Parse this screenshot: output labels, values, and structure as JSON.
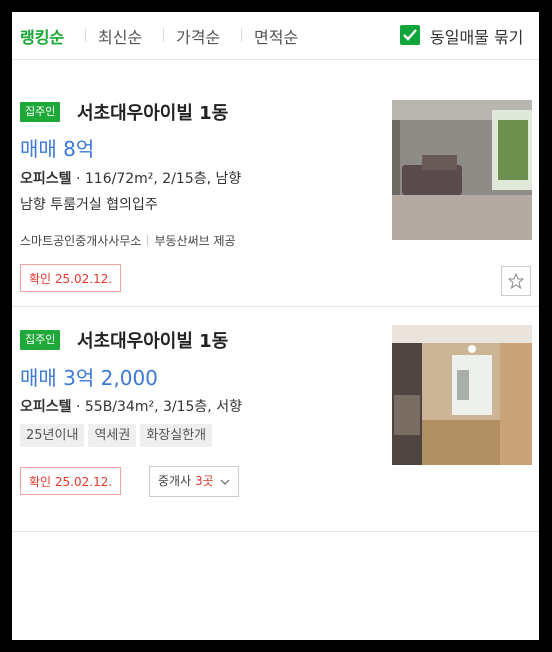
{
  "sort": {
    "ranking": "랭킹순",
    "latest": "최신순",
    "price": "가격순",
    "area": "면적순",
    "same_listing_label": "동일매물 묶기"
  },
  "listings": [
    {
      "tag": "집주인",
      "name": "서초대우아이빌 1동",
      "price": "매매 8억",
      "type": "오피스텔",
      "specs": " · 116/72m², 2/15층, 남향",
      "description": "남향 투룸거실 협의입주",
      "agent": "스마트공인중개사사무소",
      "provider": "부동산써브 제공",
      "confirm": "확인 25.02.12."
    },
    {
      "tag": "집주인",
      "name": "서초대우아이빌 1동",
      "price": "매매 3억 2,000",
      "type": "오피스텔",
      "specs": " · 55B/34m², 3/15층, 서향",
      "features": [
        "25년이내",
        "역세권",
        "화장실한개"
      ],
      "confirm": "확인 25.02.12.",
      "broker_label": "중개사",
      "broker_count": "3곳"
    }
  ],
  "colors": {
    "accent": "#16a832",
    "price": "#3d79d9",
    "confirm": "#e4382a"
  }
}
